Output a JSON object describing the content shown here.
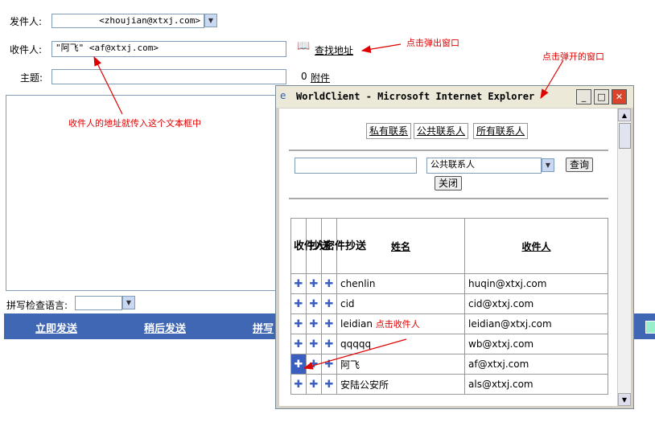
{
  "form": {
    "from_label": "发件人:",
    "from_value": "<zhoujian@xtxj.com>",
    "to_label": "收件人:",
    "to_value": "\"阿飞\" <af@xtxj.com>",
    "find_address": "查找地址",
    "subject_label": "主题:",
    "subject_value": "",
    "attachment_label": "附件",
    "spellcheck_label": "拼写检查语言:",
    "spellcheck_value": ""
  },
  "bottom_bar": {
    "send_now": "立即发送",
    "send_later": "稍后发送",
    "spell_partial": "拼写"
  },
  "annotations": {
    "click_popup": "点击弹出窗口",
    "popup_window": "点击弹开的窗口",
    "recipient_box": "收件人的地址就传入这个文本框中",
    "click_recipient": "点击收件人"
  },
  "popup": {
    "title": "WorldClient - Microsoft Internet Explorer",
    "tabs": [
      "私有联系",
      "公共联系人",
      "所有联系人"
    ],
    "search_value": "",
    "category_select": "公共联系人",
    "query_button": "查询",
    "close_button": "关闭",
    "table": {
      "col_to": "收件人",
      "col_cc": "抄送",
      "col_bcc": "密件抄送",
      "col_name": "姓名",
      "col_recipient": "收件人",
      "rows": [
        {
          "name": "chenlin",
          "email": "huqin@xtxj.com"
        },
        {
          "name": "cid",
          "email": "cid@xtxj.com"
        },
        {
          "name": "leidian",
          "email": "leidian@xtxj.com"
        },
        {
          "name": "qqqqq",
          "email": "wb@xtxj.com"
        },
        {
          "name": "阿飞",
          "email": "af@xtxj.com"
        },
        {
          "name": "安陆公安所",
          "email": "als@xtxj.com"
        }
      ]
    }
  },
  "colors": {
    "annotation_red": "#e00000",
    "bar_blue": "#3f67b3",
    "icon_blue": "#3b5fc0"
  }
}
